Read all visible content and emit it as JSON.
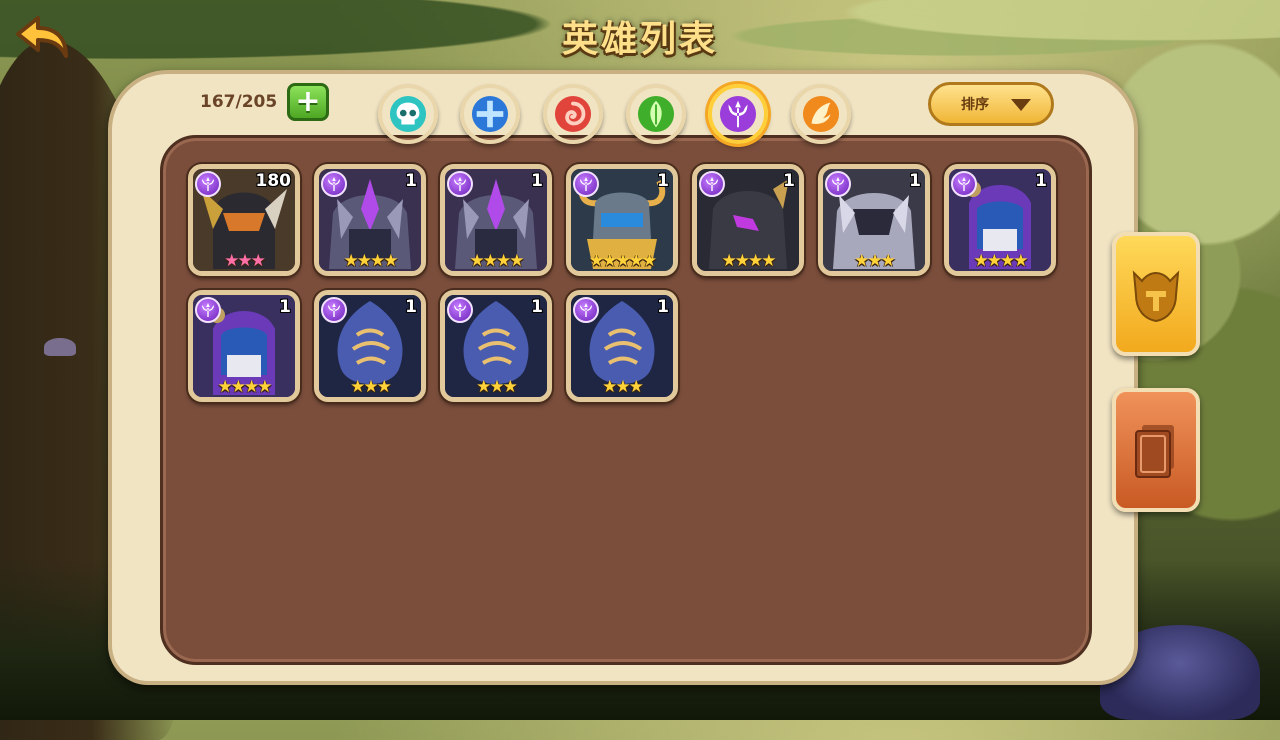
{
  "header": {
    "title": "英雄列表",
    "back_icon": "back-arrow-icon"
  },
  "toolbar": {
    "hero_count": "167/205",
    "add_icon": "plus-icon",
    "sort_label": "排序",
    "sort_icon": "chevron-down-icon"
  },
  "filters": [
    {
      "name": "shadow",
      "icon": "skull-icon",
      "color": "#2ec4c1",
      "active": false
    },
    {
      "name": "fortress",
      "icon": "cross-shield-icon",
      "color": "#2c78d8",
      "active": false
    },
    {
      "name": "abyss",
      "icon": "swirl-icon",
      "color": "#e0443a",
      "active": false
    },
    {
      "name": "forest",
      "icon": "leaf-icon",
      "color": "#3fae2a",
      "active": false
    },
    {
      "name": "dark",
      "icon": "trident-icon",
      "color": "#9b3ddb",
      "active": true
    },
    {
      "name": "light",
      "icon": "wing-icon",
      "color": "#f08a1c",
      "active": false
    }
  ],
  "side_tabs": [
    {
      "name": "heroes",
      "icon": "helmet-icon",
      "active": true
    },
    {
      "name": "cards",
      "icon": "card-icon",
      "active": false
    }
  ],
  "heroes": [
    {
      "level": "180",
      "stars": 3,
      "star_color": "pink",
      "portrait": "dark-knight-orange"
    },
    {
      "level": "1",
      "stars": 4,
      "star_color": "gold",
      "portrait": "crystal-armor"
    },
    {
      "level": "1",
      "stars": 4,
      "star_color": "gold",
      "portrait": "crystal-armor"
    },
    {
      "level": "1",
      "stars": 5,
      "star_color": "gold",
      "portrait": "horned-blue-warrior"
    },
    {
      "level": "1",
      "stars": 4,
      "star_color": "gold",
      "portrait": "dark-knight-purple"
    },
    {
      "level": "1",
      "stars": 3,
      "star_color": "gold",
      "portrait": "silver-armor"
    },
    {
      "level": "1",
      "stars": 4,
      "star_color": "gold",
      "portrait": "hooded-mage"
    },
    {
      "level": "1",
      "stars": 4,
      "star_color": "gold",
      "portrait": "hooded-mage"
    },
    {
      "level": "1",
      "stars": 3,
      "star_color": "gold",
      "portrait": "blue-flame-spirit"
    },
    {
      "level": "1",
      "stars": 3,
      "star_color": "gold",
      "portrait": "blue-flame-spirit"
    },
    {
      "level": "1",
      "stars": 3,
      "star_color": "gold",
      "portrait": "blue-flame-spirit"
    }
  ],
  "colors": {
    "panel_bg": "#f1e4c3",
    "inner_bg": "#7b4e3b",
    "title_color": "#ffe08a",
    "faction_purple": "#9b3ddb"
  }
}
